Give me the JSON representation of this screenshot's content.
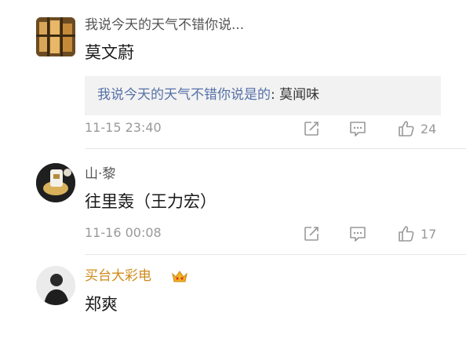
{
  "comments": [
    {
      "username": "我说今天的天气不错你说...",
      "text": "莫文蔚",
      "reply": {
        "quoted": "我说今天的天气不错你说是的",
        "separator": ":",
        "author": "莫闻味"
      },
      "timestamp": "11-15 23:40",
      "likes": "24",
      "icons": [
        "share-icon",
        "comment-icon",
        "like-icon"
      ]
    },
    {
      "username": "山·黎",
      "text": "往里轰（王力宏）",
      "timestamp": "11-16 00:08",
      "likes": "17",
      "icons": [
        "share-icon",
        "comment-icon",
        "like-icon"
      ]
    },
    {
      "username": "买台大彩电",
      "text": "郑爽",
      "icons": [
        "vip-crown-icon"
      ]
    }
  ],
  "colors": {
    "username_gray": "#555555",
    "username_vip": "#d08a1a",
    "reply_link": "#5570a8",
    "meta_gray": "#999999",
    "reply_bg": "#f2f2f2"
  }
}
